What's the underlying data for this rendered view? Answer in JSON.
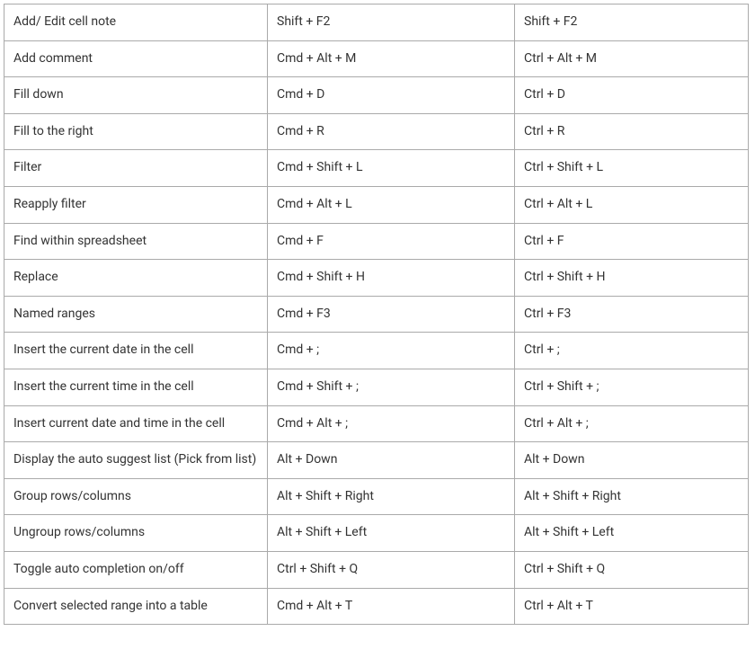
{
  "shortcuts": [
    {
      "action": "Add/ Edit cell note",
      "mac": "Shift + F2",
      "win": "Shift + F2"
    },
    {
      "action": "Add comment",
      "mac": "Cmd + Alt + M",
      "win": "Ctrl + Alt + M"
    },
    {
      "action": "Fill down",
      "mac": "Cmd + D",
      "win": "Ctrl + D"
    },
    {
      "action": "Fill to the right",
      "mac": "Cmd + R",
      "win": "Ctrl + R"
    },
    {
      "action": "Filter",
      "mac": "Cmd + Shift + L",
      "win": "Ctrl + Shift + L"
    },
    {
      "action": "Reapply filter",
      "mac": "Cmd + Alt + L",
      "win": "Ctrl + Alt + L"
    },
    {
      "action": "Find within spreadsheet",
      "mac": "Cmd + F",
      "win": "Ctrl + F"
    },
    {
      "action": "Replace",
      "mac": "Cmd + Shift + H",
      "win": "Ctrl + Shift + H"
    },
    {
      "action": "Named ranges",
      "mac": "Cmd + F3",
      "win": "Ctrl + F3"
    },
    {
      "action": "Insert the current date in the cell",
      "mac": "Cmd + ;",
      "win": "Ctrl + ;"
    },
    {
      "action": "Insert the current time in the cell",
      "mac": "Cmd + Shift + ;",
      "win": "Ctrl + Shift + ;"
    },
    {
      "action": "Insert current date and time in the cell",
      "mac": "Cmd + Alt + ;",
      "win": "Ctrl + Alt + ;"
    },
    {
      "action": "Display the auto suggest list (Pick from list)",
      "mac": "Alt + Down",
      "win": "Alt + Down"
    },
    {
      "action": "Group rows/columns",
      "mac": "Alt + Shift + Right",
      "win": "Alt + Shift + Right"
    },
    {
      "action": "Ungroup rows/columns",
      "mac": "Alt + Shift + Left",
      "win": "Alt + Shift + Left"
    },
    {
      "action": "Toggle auto completion on/off",
      "mac": "Ctrl + Shift + Q",
      "win": "Ctrl + Shift + Q"
    },
    {
      "action": "Convert selected range into a table",
      "mac": "Cmd + Alt + T",
      "win": "Ctrl + Alt + T"
    }
  ]
}
